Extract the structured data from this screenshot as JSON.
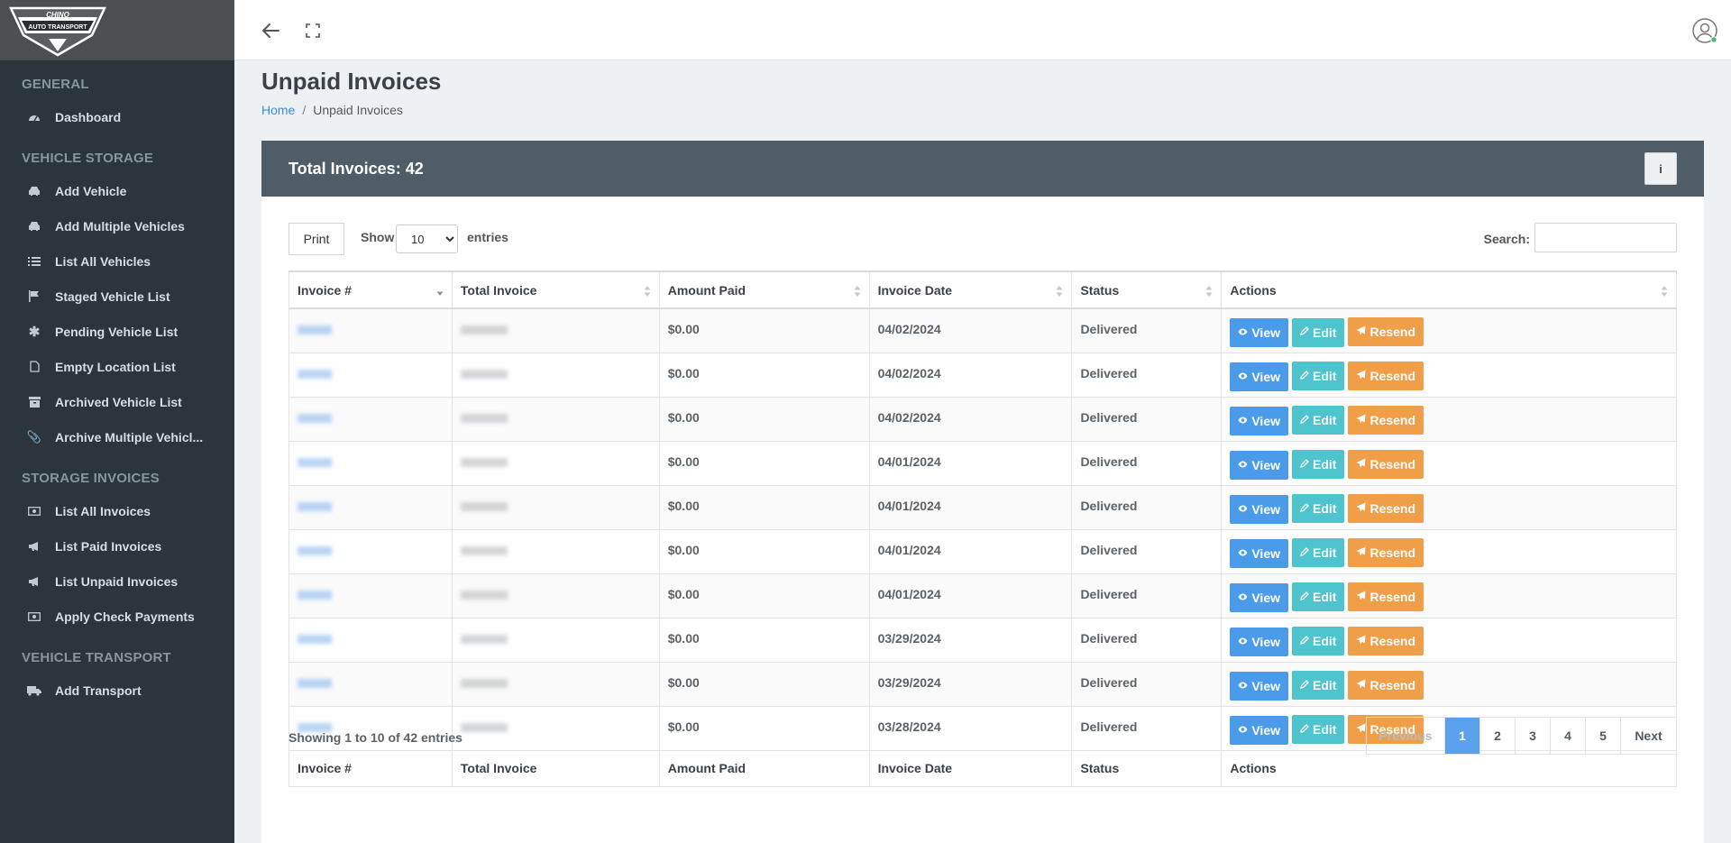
{
  "app": {
    "logo_alt": "CHINO AUTO TRANSPORT"
  },
  "sidebar": {
    "sections": [
      {
        "title": "GENERAL",
        "items": [
          {
            "label": "Dashboard",
            "icon": "tachometer-icon"
          }
        ]
      },
      {
        "title": "VEHICLE STORAGE",
        "items": [
          {
            "label": "Add Vehicle",
            "icon": "car-icon"
          },
          {
            "label": "Add Multiple Vehicles",
            "icon": "car-icon"
          },
          {
            "label": "List All Vehicles",
            "icon": "list-icon"
          },
          {
            "label": "Staged Vehicle List",
            "icon": "flag-icon"
          },
          {
            "label": "Pending Vehicle List",
            "icon": "asterisk-icon"
          },
          {
            "label": "Empty Location List",
            "icon": "file-icon"
          },
          {
            "label": "Archived Vehicle List",
            "icon": "archive-icon"
          },
          {
            "label": "Archive Multiple Vehicl...",
            "icon": "paperclip-icon"
          }
        ]
      },
      {
        "title": "STORAGE INVOICES",
        "items": [
          {
            "label": "List All Invoices",
            "icon": "money-icon"
          },
          {
            "label": "List Paid Invoices",
            "icon": "bullhorn-icon"
          },
          {
            "label": "List Unpaid Invoices",
            "icon": "bullhorn-icon"
          },
          {
            "label": "Apply Check Payments",
            "icon": "money-icon"
          }
        ]
      },
      {
        "title": "VEHICLE TRANSPORT",
        "items": [
          {
            "label": "Add Transport",
            "icon": "truck-icon"
          }
        ]
      }
    ]
  },
  "page": {
    "title": "Unpaid Invoices",
    "breadcrumb": {
      "home": "Home",
      "separator": "/",
      "current": "Unpaid Invoices"
    }
  },
  "card": {
    "header": "Total Invoices: 42",
    "info_label": "i"
  },
  "controls": {
    "print_label": "Print",
    "show_label": "Show",
    "entries_value": "10",
    "entries_label": "entries",
    "search_label": "Search:",
    "search_value": ""
  },
  "table": {
    "columns": [
      "Invoice #",
      "Total Invoice",
      "Amount Paid",
      "Invoice Date",
      "Status",
      "Actions"
    ],
    "rows": [
      {
        "amount_paid": "$0.00",
        "date": "04/02/2024",
        "status": "Delivered"
      },
      {
        "amount_paid": "$0.00",
        "date": "04/02/2024",
        "status": "Delivered"
      },
      {
        "amount_paid": "$0.00",
        "date": "04/02/2024",
        "status": "Delivered"
      },
      {
        "amount_paid": "$0.00",
        "date": "04/01/2024",
        "status": "Delivered"
      },
      {
        "amount_paid": "$0.00",
        "date": "04/01/2024",
        "status": "Delivered"
      },
      {
        "amount_paid": "$0.00",
        "date": "04/01/2024",
        "status": "Delivered"
      },
      {
        "amount_paid": "$0.00",
        "date": "04/01/2024",
        "status": "Delivered"
      },
      {
        "amount_paid": "$0.00",
        "date": "03/29/2024",
        "status": "Delivered"
      },
      {
        "amount_paid": "$0.00",
        "date": "03/29/2024",
        "status": "Delivered"
      },
      {
        "amount_paid": "$0.00",
        "date": "03/28/2024",
        "status": "Delivered"
      }
    ],
    "actions": {
      "view": "View",
      "edit": "Edit",
      "resend": "Resend"
    }
  },
  "footer": {
    "showing": "Showing 1 to 10 of 42 entries",
    "pagination": {
      "previous": "Previous",
      "pages": [
        "1",
        "2",
        "3",
        "4",
        "5"
      ],
      "active": "1",
      "next": "Next"
    }
  },
  "colors": {
    "sidebar": "#2c353c",
    "card_header": "#505d66",
    "view": "#4a9cea",
    "edit": "#4ec4cf",
    "resend": "#f19e49",
    "active_page": "#5aa3ec"
  }
}
